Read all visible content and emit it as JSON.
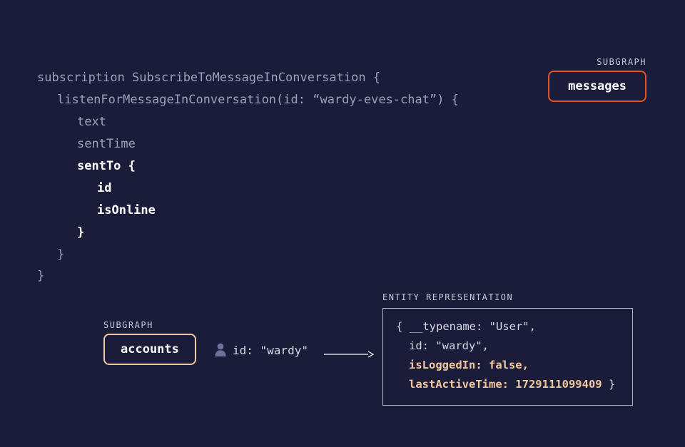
{
  "code": {
    "l1": "subscription SubscribeToMessageInConversation {",
    "l2": "listenForMessageInConversation(id: “wardy-eves-chat”) {",
    "l3": "text",
    "l4": "sentTime",
    "l5": "sentTo {",
    "l6": "id",
    "l7": "isOnline",
    "l8": "}",
    "l9": "}",
    "l10": "}"
  },
  "subgraphTop": {
    "label": "SUBGRAPH",
    "name": "messages"
  },
  "subgraphBottom": {
    "label": "SUBGRAPH",
    "name": "accounts"
  },
  "userId": "id: \"wardy\"",
  "entity": {
    "label": "ENTITY REPRESENTATION",
    "l1": "{ __typename: \"User\",",
    "l2": "id: \"wardy\",",
    "l3": "isLoggedIn: false,",
    "l4a": "lastActiveTime: 1729111099409",
    "l4b": " }"
  }
}
